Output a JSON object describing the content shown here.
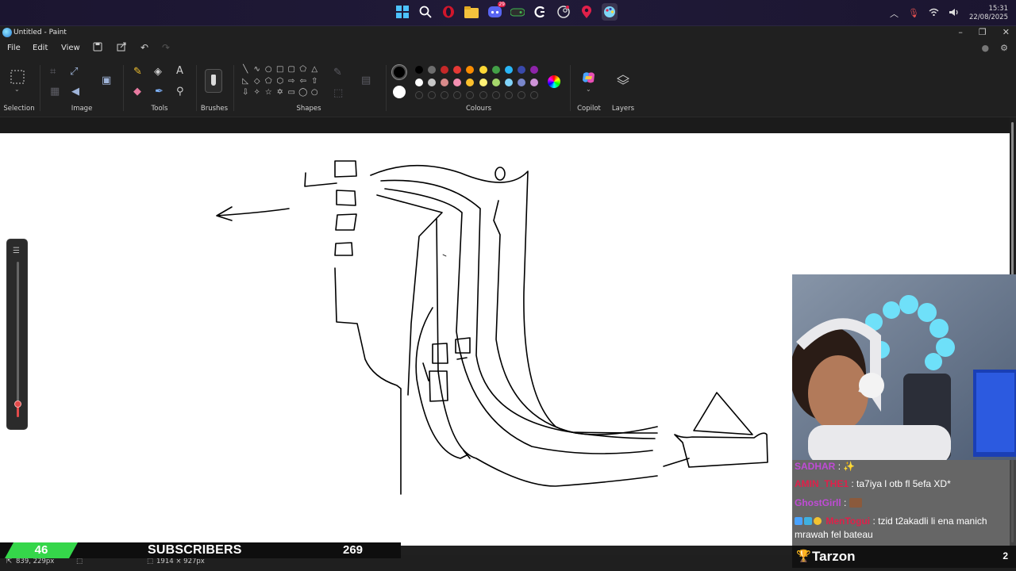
{
  "taskbar": {
    "icons": [
      "windows-start-icon",
      "search-icon",
      "opera-icon",
      "file-explorer-icon",
      "discord-icon",
      "xbox-icon",
      "logitech-icon",
      "steam-icon",
      "maps-pin-icon",
      "paint-icon"
    ],
    "discord_badge": "29",
    "time": "15:31",
    "date": "22/08/2025"
  },
  "window": {
    "title": "Untitled - Paint",
    "minimize": "–",
    "maximize": "❐",
    "close": "✕"
  },
  "menu": {
    "file": "File",
    "edit": "Edit",
    "view": "View"
  },
  "ribbon": {
    "selection": "Selection",
    "image": "Image",
    "tools": "Tools",
    "brushes": "Brushes",
    "shapes": "Shapes",
    "colours": "Colours",
    "copilot": "Copilot",
    "layers": "Layers"
  },
  "colors": {
    "primary": "#000000",
    "secondary": "#ffffff",
    "row1": [
      "#000000",
      "#6e6e6e",
      "#c62828",
      "#e53935",
      "#fb8c00",
      "#fdd835",
      "#43a047",
      "#29b6f6",
      "#3949ab",
      "#8e24aa"
    ],
    "row2": [
      "#ffffff",
      "#c7c7c7",
      "#d88a8a",
      "#f48fb1",
      "#fbc02d",
      "#fff176",
      "#a5d66b",
      "#81d4fa",
      "#7986cb",
      "#ce93d8"
    ]
  },
  "status": {
    "cursor_pos": "839, 229px",
    "canvas_size": "1914 × 927px"
  },
  "zoom_level": 0.08,
  "stream": {
    "subs_count": "46",
    "subs_label": "SUBSCRIBERS",
    "subs_goal": "269",
    "chat": [
      {
        "user": "SADHAR",
        "user_color": "#c04bd6",
        "text": ":"
      },
      {
        "user": "AMIN_THE1",
        "user_color": "#e0204a",
        "text": ": ta7iya l otb fl 5efa XD*"
      },
      {
        "user": "GhostGirll",
        "user_color": "#c04bd6",
        "text": ":"
      },
      {
        "user": "MenTogui",
        "user_color": "#e0204a",
        "text": ": tzid t2akadli li ena manich mrawah fel bateau"
      }
    ],
    "top_name": "Tarzon",
    "top_count": "2"
  }
}
